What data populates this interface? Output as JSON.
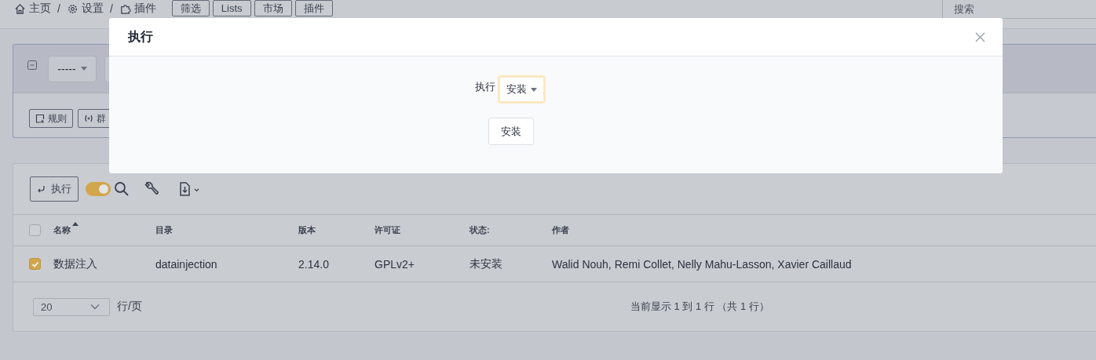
{
  "topbar": {
    "breadcrumbs": [
      "主页",
      "设置",
      "插件"
    ],
    "separators": [
      "/",
      "/"
    ],
    "buttons": [
      "筛选",
      "Lists",
      "市场",
      "插件"
    ],
    "search": {
      "placeholder": "搜索"
    }
  },
  "search_panel": {
    "select_value": "-----",
    "buttons": [
      "规则",
      "群"
    ]
  },
  "toolbar": {
    "action_button": "执行",
    "toggle": {
      "on": true
    }
  },
  "table": {
    "header_checked": false,
    "columns": [
      {
        "label": "名称",
        "sorted": true
      },
      {
        "label": "目录",
        "sorted": false
      },
      {
        "label": "版本",
        "sorted": false
      },
      {
        "label": "许可证",
        "sorted": false
      },
      {
        "label": "状态:",
        "sorted": false
      },
      {
        "label": "作者",
        "sorted": false
      }
    ],
    "rows": [
      {
        "selected": true,
        "cells": [
          "数据注入",
          "datainjection",
          "2.14.0",
          "GPLv2+",
          "未安装",
          "Walid Nouh, Remi Collet, Nelly Mahu-Lasson, Xavier Caillaud"
        ]
      }
    ]
  },
  "footer": {
    "page_size": "20",
    "per_page_label": "行/页",
    "summary": "当前显示 1 到 1 行 （共 1 行）"
  },
  "modal": {
    "title": "执行",
    "field_label": "执行",
    "select_value": "安装",
    "button": "安装"
  }
}
